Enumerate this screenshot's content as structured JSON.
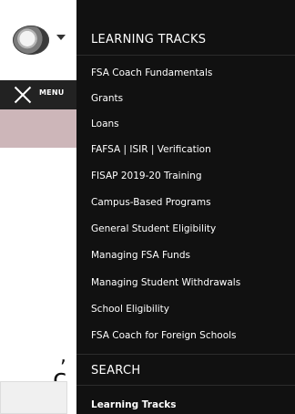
{
  "background": {
    "menu_label": "MENU",
    "partial_comma": ",",
    "partial_c": "c"
  },
  "panel": {
    "learning_tracks_title": "LEARNING TRACKS",
    "items": [
      {
        "label": "FSA Coach Fundamentals"
      },
      {
        "label": "Grants"
      },
      {
        "label": "Loans"
      },
      {
        "label": "FAFSA | ISIR | Verification"
      },
      {
        "label": "FISAP 2019-20 Training"
      },
      {
        "label": "Campus-Based Programs"
      },
      {
        "label": "General Student Eligibility"
      },
      {
        "label": "Managing FSA Funds"
      },
      {
        "label": "Managing Student Withdrawals"
      },
      {
        "label": "School Eligibility"
      },
      {
        "label": "FSA Coach for Foreign Schools"
      }
    ],
    "search_title": "SEARCH",
    "search_item": "Learning Tracks"
  }
}
